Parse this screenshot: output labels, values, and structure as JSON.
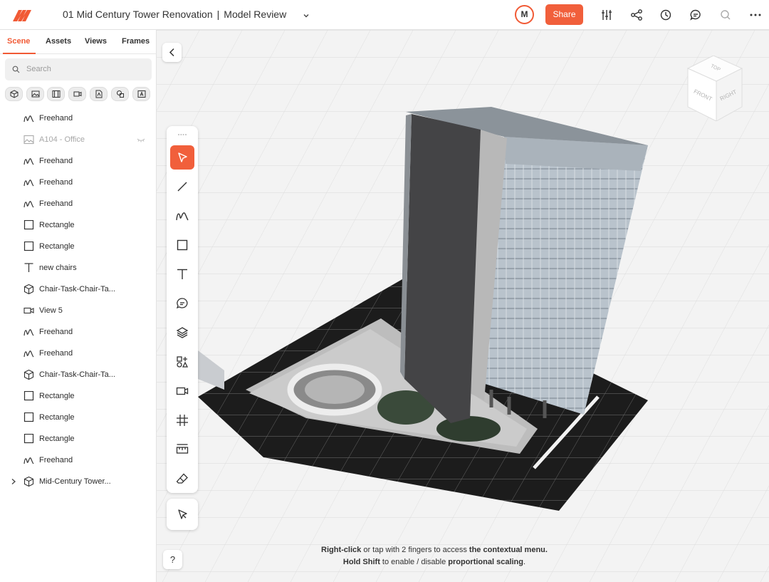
{
  "header": {
    "project_title": "01 Mid Century Tower Renovation",
    "separator": "|",
    "view_title": "Model Review",
    "avatar_initial": "M",
    "share_label": "Share",
    "accent_color": "#f15f3b",
    "icons": [
      "sliders-icon",
      "share-nodes-icon",
      "history-icon",
      "comments-icon",
      "search-icon",
      "more-icon"
    ]
  },
  "sidebar": {
    "tabs": [
      {
        "label": "Scene",
        "active": true
      },
      {
        "label": "Assets",
        "active": false
      },
      {
        "label": "Views",
        "active": false
      },
      {
        "label": "Frames",
        "active": false
      }
    ],
    "search_placeholder": "Search",
    "filters": [
      "model-filter-icon",
      "image-filter-icon",
      "film-filter-icon",
      "camera-filter-icon",
      "document-filter-icon",
      "shapes-filter-icon",
      "text-filter-icon"
    ],
    "items": [
      {
        "label": "Freehand",
        "icon": "freehand-icon"
      },
      {
        "label": "A104 - Office",
        "icon": "image-icon",
        "hidden": true
      },
      {
        "label": "Freehand",
        "icon": "freehand-icon"
      },
      {
        "label": "Freehand",
        "icon": "freehand-icon"
      },
      {
        "label": "Freehand",
        "icon": "freehand-icon"
      },
      {
        "label": "Rectangle",
        "icon": "rectangle-icon"
      },
      {
        "label": "Rectangle",
        "icon": "rectangle-icon"
      },
      {
        "label": "new chairs",
        "icon": "text-icon"
      },
      {
        "label": "Chair-Task-Chair-Ta...",
        "icon": "model-icon"
      },
      {
        "label": "View 5",
        "icon": "camera-icon"
      },
      {
        "label": "Freehand",
        "icon": "freehand-icon"
      },
      {
        "label": "Freehand",
        "icon": "freehand-icon"
      },
      {
        "label": "Chair-Task-Chair-Ta...",
        "icon": "model-icon"
      },
      {
        "label": "Rectangle",
        "icon": "rectangle-icon"
      },
      {
        "label": "Rectangle",
        "icon": "rectangle-icon"
      },
      {
        "label": "Rectangle",
        "icon": "rectangle-icon"
      },
      {
        "label": "Freehand",
        "icon": "freehand-icon"
      },
      {
        "label": "Mid-Century Tower...",
        "icon": "model-icon",
        "expandable": true
      }
    ]
  },
  "viewport": {
    "tools": [
      "select-icon",
      "line-icon",
      "freehand-icon",
      "rectangle-icon",
      "text-icon",
      "comment-icon",
      "layers-icon",
      "shapes-icon",
      "camera-icon",
      "grid-icon",
      "measure-icon",
      "eraser-icon"
    ],
    "secondary_tool": "pointer-select-icon",
    "help_label": "?",
    "cube_faces": {
      "top": "TOP",
      "front": "FRONT",
      "right": "RIGHT"
    },
    "hint": {
      "line1_a": "Right-click",
      "line1_b": " or tap with 2 fingers to access ",
      "line1_c": "the contextual menu.",
      "line2_a": "Hold Shift",
      "line2_b": " to enable / disable ",
      "line2_c": "proportional scaling",
      "line2_d": "."
    }
  }
}
